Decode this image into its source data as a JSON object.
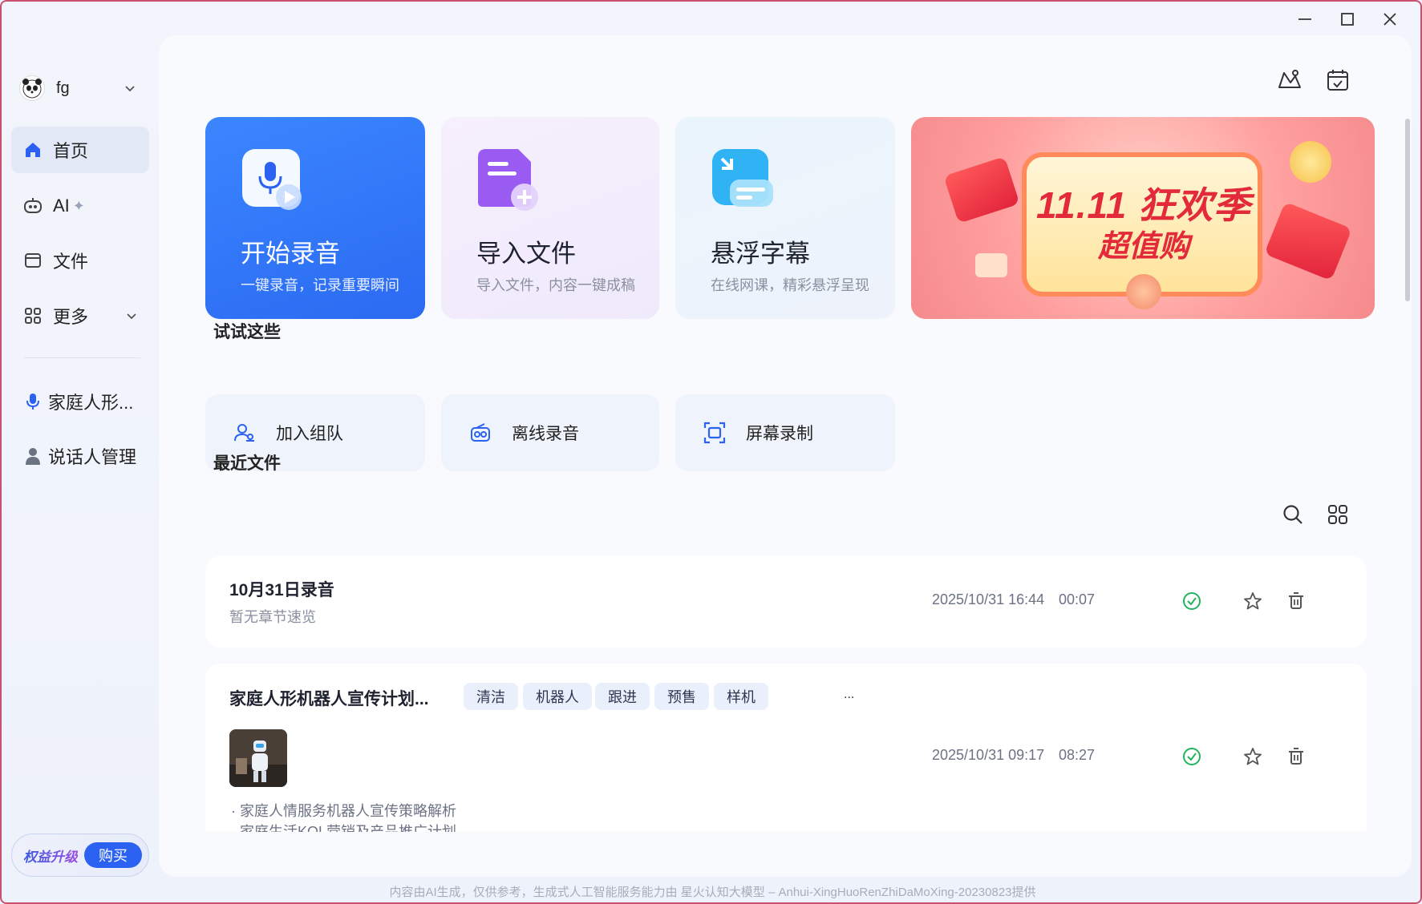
{
  "window": {
    "controls": [
      "minimize",
      "maximize",
      "close"
    ]
  },
  "sidebar": {
    "user": {
      "name": "fg",
      "avatar_icon": "panda-avatar-icon"
    },
    "nav": [
      {
        "label": "首页",
        "icon": "home-icon",
        "active": true
      },
      {
        "label": "AI",
        "suffix": "✦",
        "icon": "ai-robot-icon"
      },
      {
        "label": "文件",
        "icon": "folder-icon"
      },
      {
        "label": "更多",
        "icon": "grid-icon"
      }
    ],
    "shortcuts": [
      {
        "label": "家庭人形...",
        "icon": "microphone-icon"
      },
      {
        "label": "说话人管理",
        "icon": "person-icon"
      }
    ],
    "upgrade": {
      "label": "权益升级",
      "buy": "购买"
    }
  },
  "header": {
    "icons": [
      "sketch-icon",
      "calendar-check-icon"
    ]
  },
  "cards": {
    "record": {
      "title": "开始录音",
      "subtitle": "一键录音，记录重要瞬间"
    },
    "import": {
      "title": "导入文件",
      "subtitle": "导入文件，内容一键成稿"
    },
    "subtitle": {
      "title": "悬浮字幕",
      "subtitle": "在线网课，精彩悬浮呈现"
    },
    "promo": {
      "line1": "11.11 狂欢季",
      "line2": "超值购"
    }
  },
  "try": {
    "title": "试试这些",
    "items": [
      {
        "label": "加入组队",
        "icon": "team-icon"
      },
      {
        "label": "离线录音",
        "icon": "radio-icon"
      },
      {
        "label": "屏幕录制",
        "icon": "screen-record-icon"
      }
    ]
  },
  "recent": {
    "title": "最近文件",
    "files": [
      {
        "title": "10月31日录音",
        "subtitle": "暂无章节速览",
        "date": "2025/10/31 16:44",
        "duration": "00:07"
      },
      {
        "title": "家庭人形机器人宣传计划...",
        "tags": [
          "清洁",
          "机器人",
          "跟进",
          "预售",
          "样机"
        ],
        "more": "...",
        "date": "2025/10/31 09:17",
        "duration": "08:27",
        "bullets": [
          "家庭人情服务机器人宣传策略解析",
          "家庭生活KOL营销及产品推广计划"
        ]
      }
    ]
  },
  "footer": {
    "note": "内容由AI生成，仅供参考，生成式人工智能服务能力由 星火认知大模型 – Anhui-XingHuoRenZhiDaMoXing-20230823提供"
  },
  "colors": {
    "primary": "#2b6af2",
    "success": "#22b35e",
    "promo": "#f58a8c"
  }
}
